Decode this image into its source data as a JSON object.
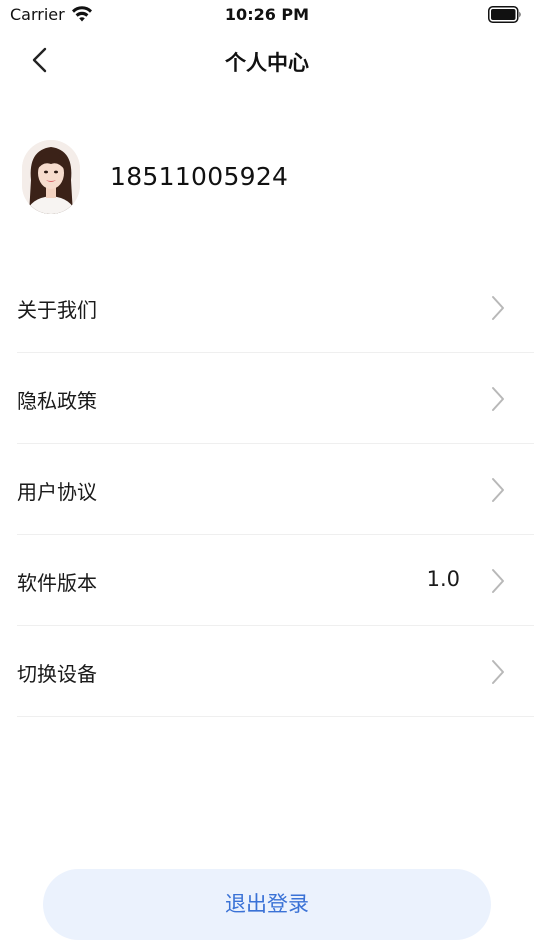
{
  "status_bar": {
    "carrier": "Carrier",
    "time": "10:26 PM"
  },
  "nav": {
    "title": "个人中心",
    "back_icon": "chevron-left-icon"
  },
  "profile": {
    "phone": "18511005924"
  },
  "menu": {
    "items": [
      {
        "label": "关于我们",
        "value": ""
      },
      {
        "label": "隐私政策",
        "value": ""
      },
      {
        "label": "用户协议",
        "value": ""
      },
      {
        "label": "软件版本",
        "value": "1.0"
      },
      {
        "label": "切换设备",
        "value": ""
      }
    ]
  },
  "logout": {
    "label": "退出登录"
  },
  "colors": {
    "accent": "#3a72d6",
    "logout_bg": "#ebf2fd",
    "divider": "#efefef",
    "chevron": "#b8b8b8"
  }
}
